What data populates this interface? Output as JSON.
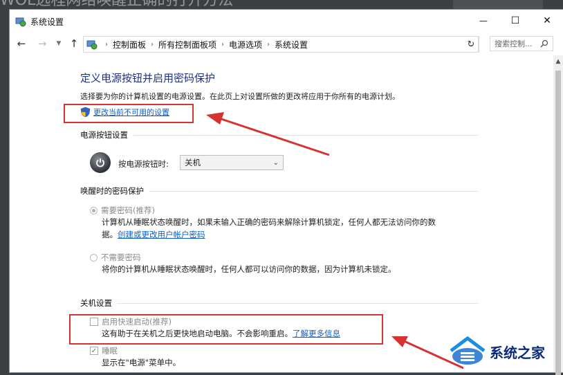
{
  "background": {
    "article_title_partial": "WOL远程网络唤醒正确的打开方法"
  },
  "window": {
    "title": "系统设置",
    "controls": {
      "minimize": "—",
      "maximize": "☐",
      "close": "✕"
    }
  },
  "address": {
    "breadcrumbs": [
      "控制面板",
      "所有控制面板项",
      "电源选项",
      "系统设置"
    ],
    "search_placeholder": "搜索控制..."
  },
  "page": {
    "heading": "定义电源按钮并启用密码保护",
    "description": "选择要为你的计算机设置的电源设置。在此页上对设置所做的更改将应用于你所有的电源计划。",
    "change_link": "更改当前不可用的设置",
    "power_section": {
      "title": "电源按钮设置",
      "label": "按电源按钮时:",
      "selected": "关机"
    },
    "wake_section": {
      "title": "唤醒时的密码保护",
      "option_require": "需要密码(推荐)",
      "option_require_desc1": "计算机从睡眠状态唤醒时，如果未输入正确的密码来解除计算机锁定，任何人都无法访问你的数",
      "option_require_desc2_prefix": "据。",
      "option_require_link": "创建或更改用户帐户密码",
      "option_none": "不需要密码",
      "option_none_desc": "将你的计算机从睡眠状态唤醒时，任何人都可以访问你的数据，因为计算机未锁定。"
    },
    "shutdown_section": {
      "title": "关机设置",
      "fast_startup": "启用快速启动(推荐)",
      "fast_startup_desc": "这有助于在关机之后更快地启动电脑。不会影响重启。",
      "fast_startup_link": "了解更多信息",
      "sleep": "睡眠",
      "sleep_desc": "显示在\"电源\"菜单中。"
    }
  },
  "watermark": {
    "text": "系统之家"
  },
  "colors": {
    "heading": "#1e3287",
    "link": "#0b5fc9",
    "annotation": "#d63232"
  }
}
